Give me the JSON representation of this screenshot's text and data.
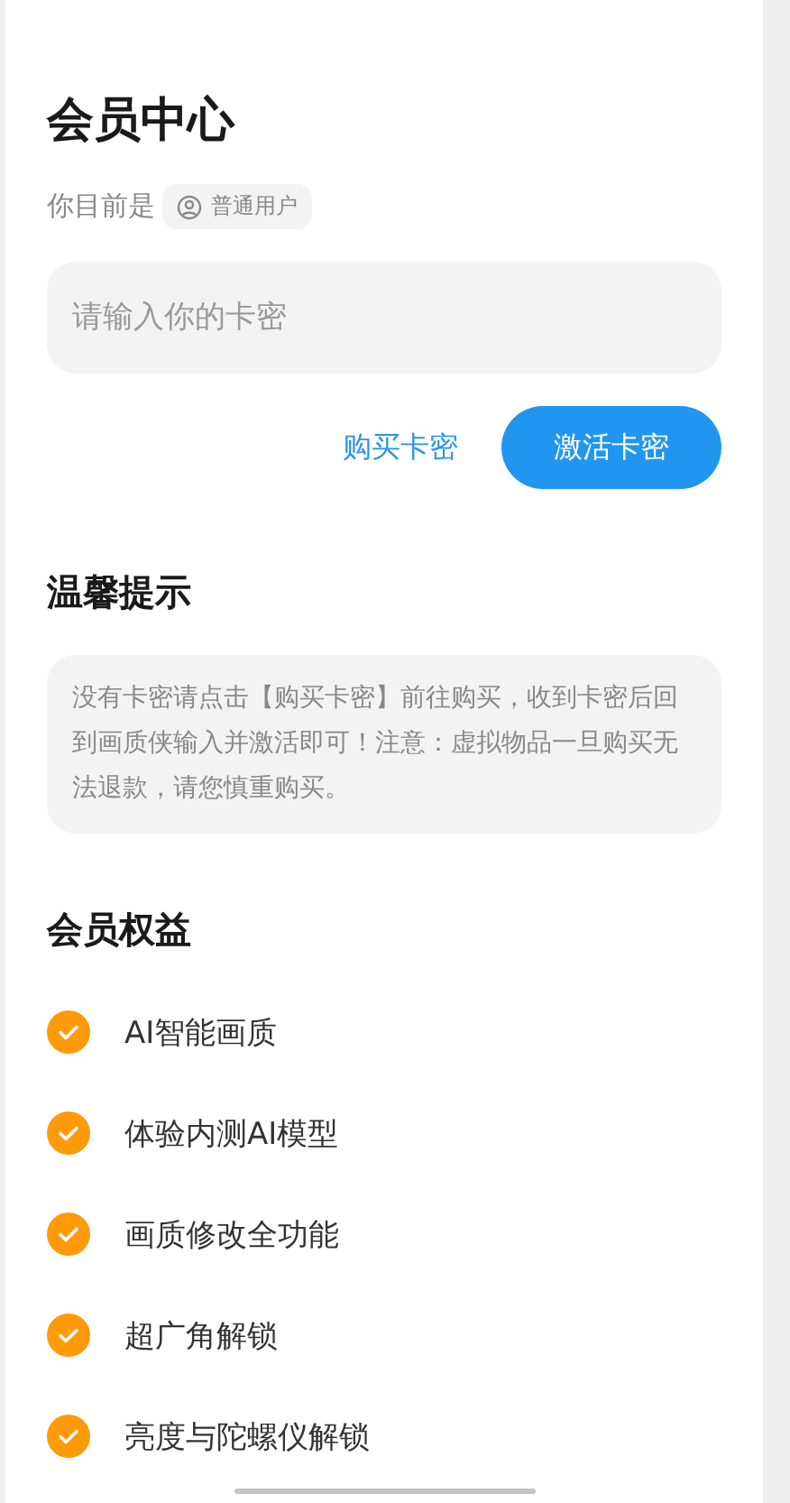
{
  "title": "会员中心",
  "status": {
    "label": "你目前是",
    "badge": "普通用户"
  },
  "card_field": {
    "placeholder": "请输入你的卡密"
  },
  "buy_link": "购买卡密",
  "activate_button": "激活卡密",
  "tips": {
    "title": "温馨提示",
    "text": "没有卡密请点击【购买卡密】前往购买，收到卡密后回到画质侠输入并激活即可！注意：虚拟物品一旦购买无法退款，请您慎重购买。"
  },
  "benefits": {
    "title": "会员权益",
    "items": [
      {
        "label": "AI智能画质",
        "checked": true
      },
      {
        "label": "体验内测AI模型",
        "checked": true
      },
      {
        "label": "画质修改全功能",
        "checked": true
      },
      {
        "label": "超广角解锁",
        "checked": true
      },
      {
        "label": "亮度与陀螺仪解锁",
        "checked": true
      }
    ]
  }
}
